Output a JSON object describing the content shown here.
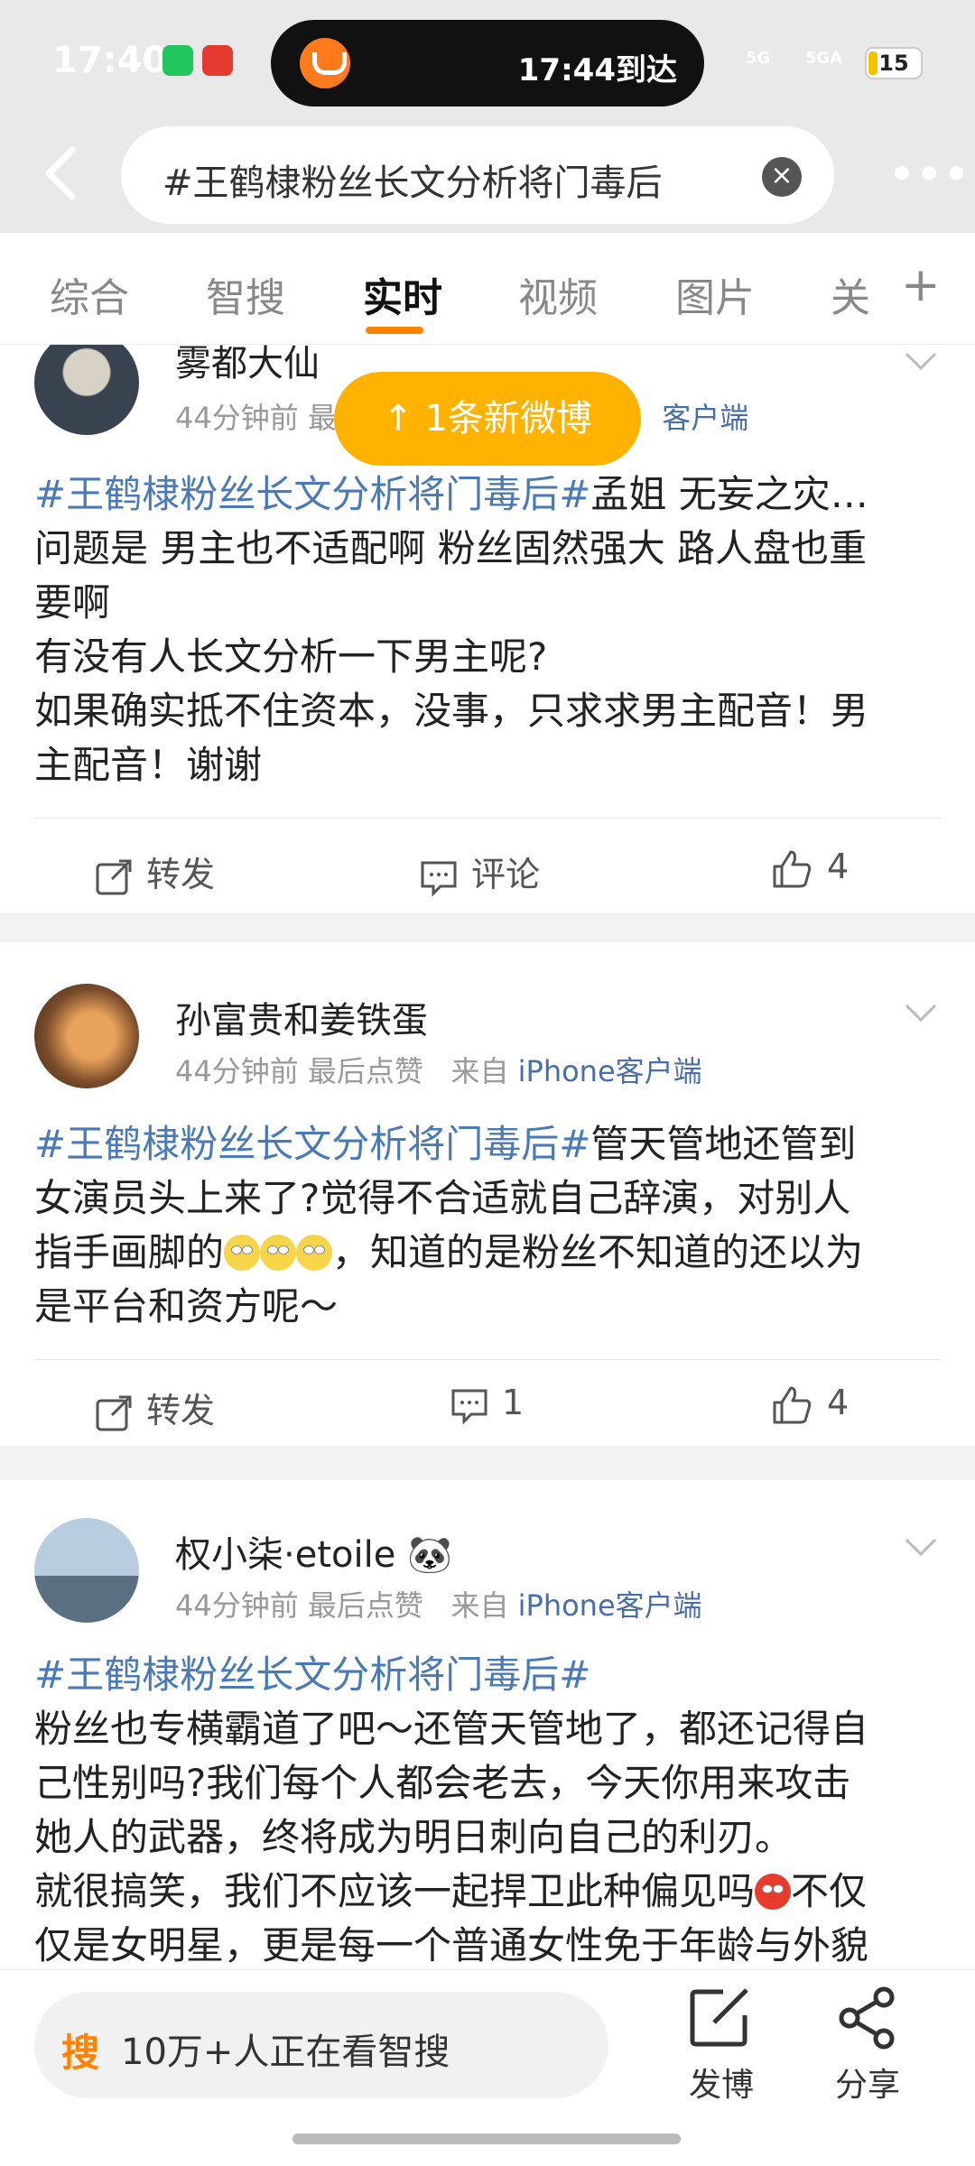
{
  "status_bar": {
    "time": "17:40",
    "island_text": "17:44到达",
    "signal_1": "5G",
    "signal_2": "5GA",
    "battery": "15"
  },
  "search": {
    "query": "#王鹤棣粉丝长文分析将门毒后"
  },
  "tabs": [
    {
      "label": "综合"
    },
    {
      "label": "智搜"
    },
    {
      "label": "实时"
    },
    {
      "label": "视频"
    },
    {
      "label": "图片"
    },
    {
      "label": "关"
    }
  ],
  "new_posts": "↑  1条新微博",
  "posts": [
    {
      "username": "雾都大仙",
      "time": "44分钟前",
      "meta_extra": "最",
      "client_tail": "客户端",
      "lines": {
        "l1_topic": "#王鹤棣粉丝长文分析将门毒后#",
        "l1_text": "孟姐 无妄之灾…",
        "l2": "问题是 男主也不适配啊 粉丝固然强大 路人盘也重",
        "l3": "要啊",
        "l4": "有没有人长文分析一下男主呢?",
        "l5": "如果确实抵不住资本，没事，只求求男主配音！男",
        "l6": "主配音！谢谢"
      },
      "repost": "转发",
      "comment": "评论",
      "likes": "4"
    },
    {
      "username": "孙富贵和姜铁蛋",
      "time": "44分钟前",
      "meta_extra": "最后点赞",
      "source_prefix": "来自",
      "source": "iPhone客户端",
      "lines": {
        "l1_topic": "#王鹤棣粉丝长文分析将门毒后#",
        "l1_text": "管天管地还管到",
        "l2": "女演员头上来了?觉得不合适就自己辞演，对别人",
        "l3a": "指手画脚的",
        "l3b": "，知道的是粉丝不知道的还以为",
        "l4": "是平台和资方呢～"
      },
      "repost": "转发",
      "comment": "1",
      "likes": "4"
    },
    {
      "username": "权小柒·etoile",
      "time": "44分钟前",
      "meta_extra": "最后点赞",
      "source_prefix": "来自",
      "source": "iPhone客户端",
      "lines": {
        "l1_topic": "#王鹤棣粉丝长文分析将门毒后#",
        "l2": "粉丝也专横霸道了吧～还管天管地了，都还记得自",
        "l3": "己性别吗?我们每个人都会老去，今天你用来攻击",
        "l4": "她人的武器，终将成为明日刺向自己的利刃。",
        "l5a": "就很搞笑，我们不应该一起捍卫此种偏见吗",
        "l5b": "不仅",
        "l6": "仅是女明星，更是每一个普通女性免于年龄与外貌"
      }
    }
  ],
  "bottom": {
    "ai_logo": "搜",
    "ai_text": "10万+人正在看智搜",
    "post_label": "发博",
    "share_label": "分享"
  },
  "colors": {
    "accent": "#ff8200",
    "topic": "#4a7ab5",
    "pill": "#ffb300"
  }
}
